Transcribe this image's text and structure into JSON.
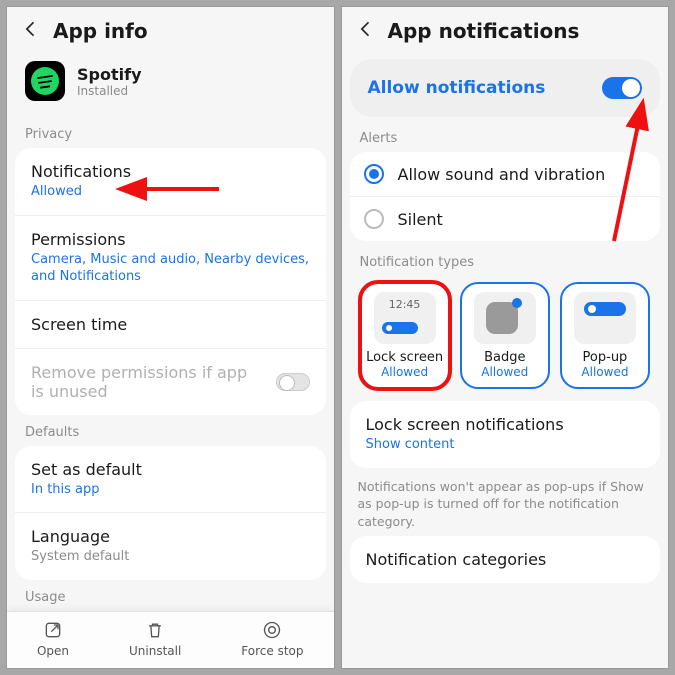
{
  "left": {
    "title": "App info",
    "app": {
      "name": "Spotify",
      "status": "Installed"
    },
    "privacy_label": "Privacy",
    "notifications": {
      "title": "Notifications",
      "sub": "Allowed"
    },
    "permissions": {
      "title": "Permissions",
      "sub": "Camera, Music and audio, Nearby devices, and Notifications"
    },
    "screen_time": {
      "title": "Screen time"
    },
    "remove_perm": {
      "title": "Remove permissions if app is unused"
    },
    "defaults_label": "Defaults",
    "set_default": {
      "title": "Set as default",
      "sub": "In this app"
    },
    "language": {
      "title": "Language",
      "sub": "System default"
    },
    "usage_label": "Usage",
    "actions": {
      "open": "Open",
      "uninstall": "Uninstall",
      "force_stop": "Force stop"
    }
  },
  "right": {
    "title": "App notifications",
    "allow": "Allow notifications",
    "alerts_label": "Alerts",
    "alert_sound": "Allow sound and vibration",
    "alert_silent": "Silent",
    "types_label": "Notification types",
    "types": {
      "lock": {
        "name": "Lock screen",
        "sub": "Allowed",
        "time": "12:45"
      },
      "badge": {
        "name": "Badge",
        "sub": "Allowed"
      },
      "popup": {
        "name": "Pop-up",
        "sub": "Allowed"
      }
    },
    "lock_notifs": {
      "title": "Lock screen notifications",
      "sub": "Show content"
    },
    "note": "Notifications won't appear as pop-ups if Show as pop-up is turned off for the notification category.",
    "categories": "Notification categories"
  }
}
